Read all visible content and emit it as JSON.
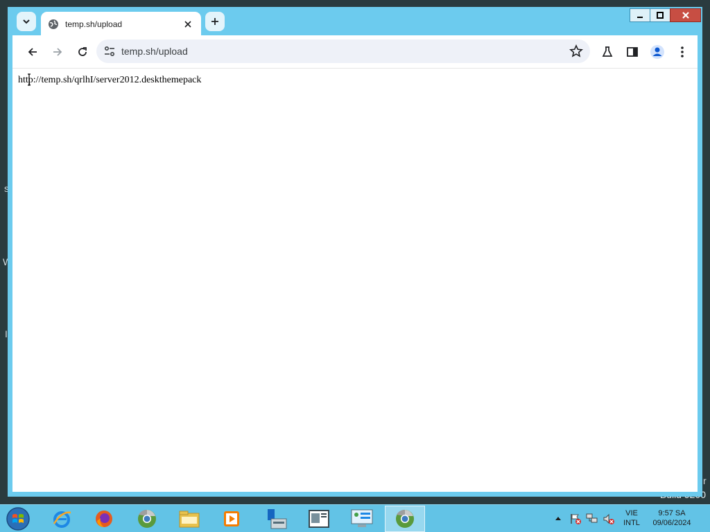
{
  "browser": {
    "tab_title": "temp.sh/upload",
    "address": "temp.sh/upload"
  },
  "page": {
    "text": "http://temp.sh/qrlhI/server2012.deskthemepack"
  },
  "desktop": {
    "build_text": "Build 9200",
    "edge_glyphs": [
      "s",
      "W",
      "I",
      "r"
    ]
  },
  "taskbar": {
    "apps": [
      "start-orb",
      "internet-explorer",
      "firefox",
      "chrome",
      "file-explorer",
      "media-player",
      "server-manager",
      "text-editor",
      "control-panel",
      "chrome-active"
    ],
    "lang_top": "VIE",
    "lang_bottom": "INTL",
    "time": "9:57 SA",
    "date": "09/06/2024"
  },
  "colors": {
    "window_frame": "#6ccbee",
    "taskbar": "#62c3e6",
    "close_button": "#c74e43"
  }
}
